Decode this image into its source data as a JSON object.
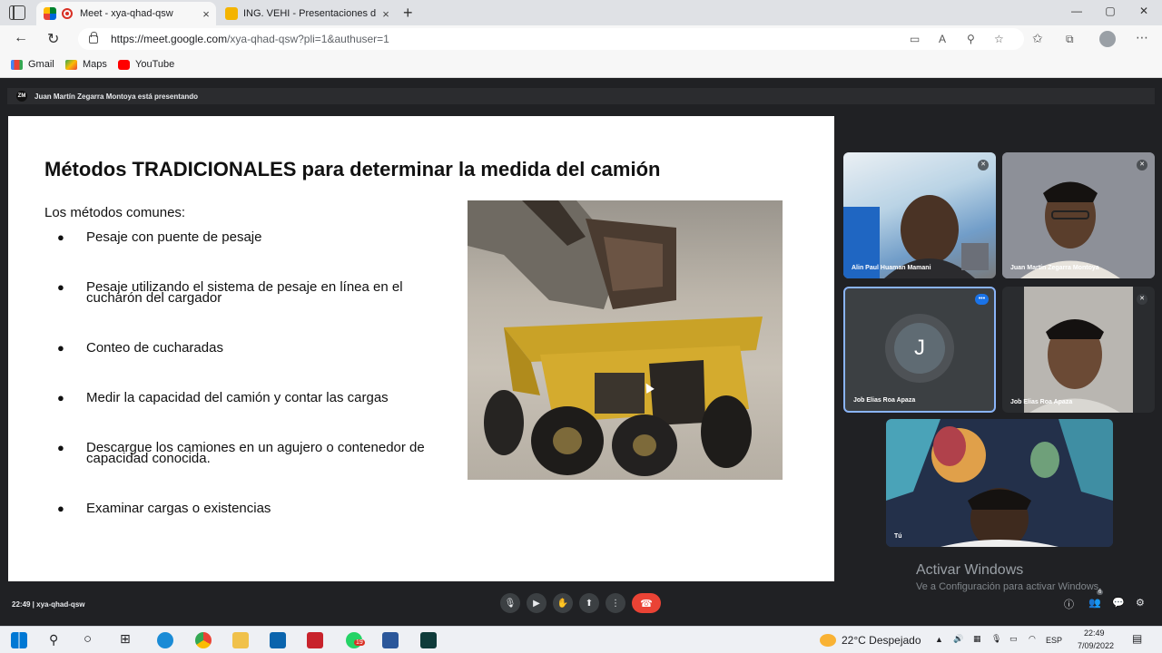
{
  "browser": {
    "tabs": [
      {
        "label": "Meet - xya-qhad-qsw",
        "close": "×"
      },
      {
        "label": "ING. VEHI - Presentaciones de Google",
        "close": "×"
      }
    ],
    "new_tab": "+",
    "window_controls": [
      "—",
      "▢",
      "✕"
    ],
    "url_host": "https://meet.google.com",
    "url_path": "/xya-qhad-qsw?pli=1&authuser=1",
    "bookmarks": [
      "Gmail",
      "Maps",
      "YouTube"
    ]
  },
  "meet": {
    "presenting_banner": "Juan Martín Zegarra Montoya está presentando",
    "presenter_initials": "ZM",
    "slide": {
      "title": "Métodos TRADICIONALES para determinar la medida del camión",
      "intro": "Los métodos comunes:",
      "bullets": [
        "Pesaje con puente de pesaje",
        "Pesaje utilizando el sistema de pesaje en línea en el cucharón del cargador",
        "Conteo de cucharadas",
        "Medir la capacidad del camión y contar las cargas",
        "Descargue los camiones en un agujero o contenedor de capacidad conocida.",
        "Examinar cargas o existencias"
      ]
    },
    "participants": [
      {
        "name": "Alin Paul Huaman Mamani"
      },
      {
        "name": "Juan Martín Zegarra Montoya"
      },
      {
        "name": "Job Elias Roa Apaza",
        "initial": "J"
      },
      {
        "name": "Job Elias Roa Apaza"
      },
      {
        "name": "Tú"
      }
    ],
    "watermark_title": "Activar Windows",
    "watermark_sub": "Ve a Configuración para activar Windows.",
    "meeting_info": "22:49  |  xya-qhad-qsw",
    "people_count": "6"
  },
  "taskbar": {
    "weather": "22°C  Despejado",
    "lang": "ESP",
    "time": "22:49",
    "date": "7/09/2022",
    "notif_count": "19"
  }
}
